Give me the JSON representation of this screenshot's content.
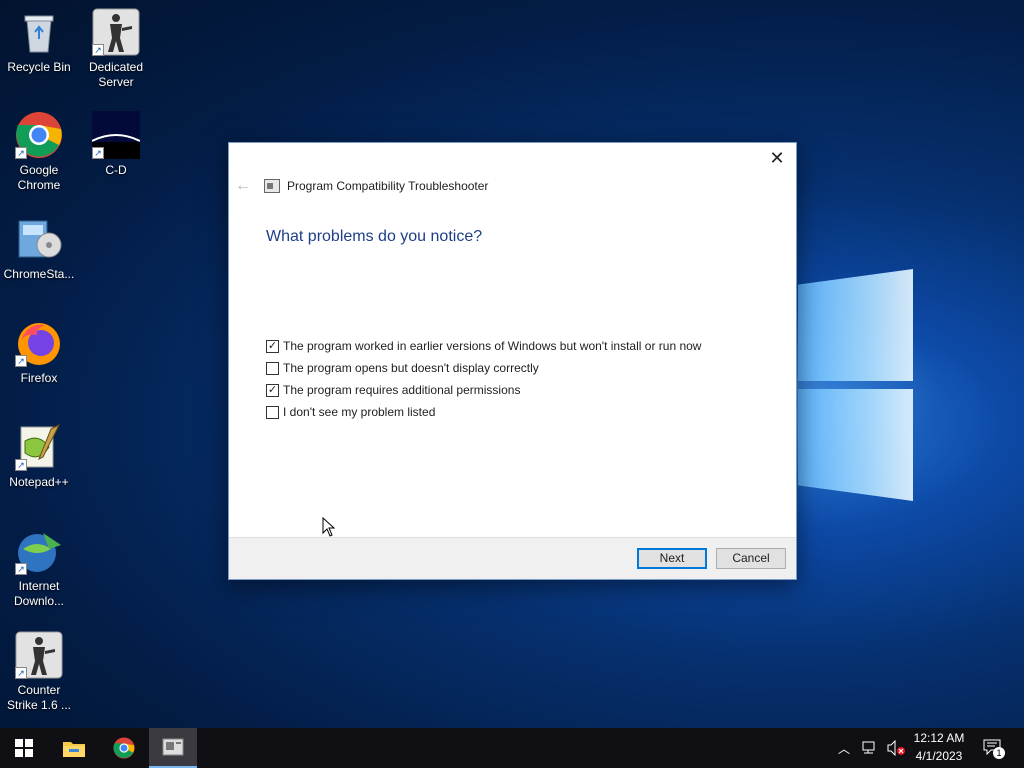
{
  "desktop": {
    "icons": [
      {
        "label_1": "Recycle Bin",
        "label_2": ""
      },
      {
        "label_1": "Dedicated",
        "label_2": "Server"
      },
      {
        "label_1": "Google",
        "label_2": "Chrome"
      },
      {
        "label_1": "C-D",
        "label_2": ""
      },
      {
        "label_1": "ChromeSta...",
        "label_2": ""
      },
      {
        "label_1": "Firefox",
        "label_2": ""
      },
      {
        "label_1": "Notepad++",
        "label_2": ""
      },
      {
        "label_1": "Internet",
        "label_2": "Downlo..."
      },
      {
        "label_1": "Counter",
        "label_2": "Strike 1.6 ..."
      }
    ]
  },
  "dialog": {
    "title": "Program Compatibility Troubleshooter",
    "heading": "What problems do you notice?",
    "options": [
      {
        "label": "The program worked in earlier versions of Windows but won't install or run now",
        "checked": true
      },
      {
        "label": "The program opens but doesn't display correctly",
        "checked": false
      },
      {
        "label": "The program requires additional permissions",
        "checked": true
      },
      {
        "label": "I don't see my problem listed",
        "checked": false
      }
    ],
    "next_label": "Next",
    "cancel_label": "Cancel",
    "close_glyph": "✕",
    "back_glyph": "←"
  },
  "taskbar": {
    "time": "12:12 AM",
    "date": "4/1/2023",
    "notification_count": "1",
    "accent": "#0078d7"
  }
}
